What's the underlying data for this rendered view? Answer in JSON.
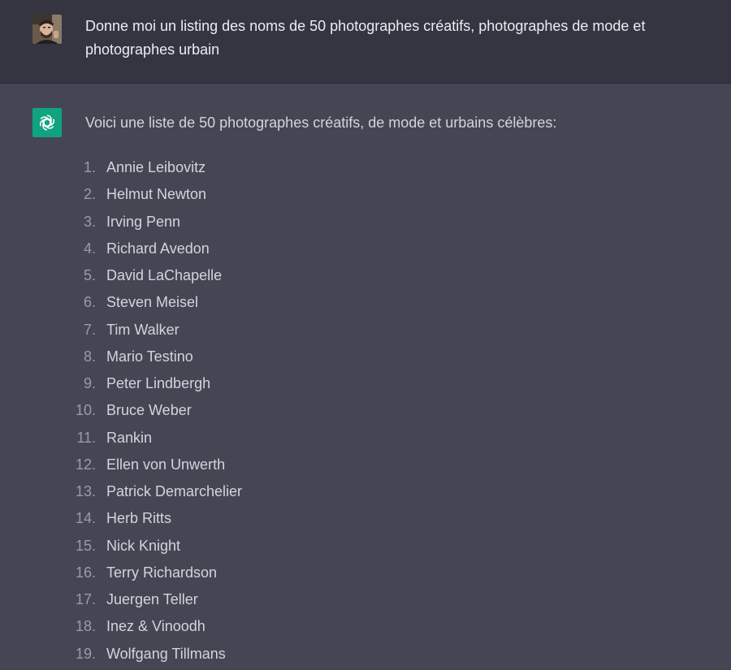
{
  "user_message": {
    "text": "Donne moi un listing des noms de 50 photographes créatifs, photographes de mode et photographes urbain"
  },
  "assistant_message": {
    "intro": "Voici une liste de 50 photographes créatifs, de mode et urbains célèbres:",
    "items": [
      {
        "num": "1.",
        "name": "Annie Leibovitz"
      },
      {
        "num": "2.",
        "name": "Helmut Newton"
      },
      {
        "num": "3.",
        "name": "Irving Penn"
      },
      {
        "num": "4.",
        "name": "Richard Avedon"
      },
      {
        "num": "5.",
        "name": "David LaChapelle"
      },
      {
        "num": "6.",
        "name": "Steven Meisel"
      },
      {
        "num": "7.",
        "name": "Tim Walker"
      },
      {
        "num": "8.",
        "name": "Mario Testino"
      },
      {
        "num": "9.",
        "name": "Peter Lindbergh"
      },
      {
        "num": "10.",
        "name": "Bruce Weber"
      },
      {
        "num": "11.",
        "name": "Rankin"
      },
      {
        "num": "12.",
        "name": "Ellen von Unwerth"
      },
      {
        "num": "13.",
        "name": "Patrick Demarchelier"
      },
      {
        "num": "14.",
        "name": "Herb Ritts"
      },
      {
        "num": "15.",
        "name": "Nick Knight"
      },
      {
        "num": "16.",
        "name": "Terry Richardson"
      },
      {
        "num": "17.",
        "name": "Juergen Teller"
      },
      {
        "num": "18.",
        "name": "Inez & Vinoodh"
      },
      {
        "num": "19.",
        "name": "Wolfgang Tillmans"
      }
    ]
  },
  "icons": {
    "user_avatar": "user-photo-avatar",
    "assistant_avatar": "openai-logo-icon"
  },
  "colors": {
    "user_bg": "#343541",
    "assistant_bg": "#444654",
    "accent": "#10a37f"
  }
}
